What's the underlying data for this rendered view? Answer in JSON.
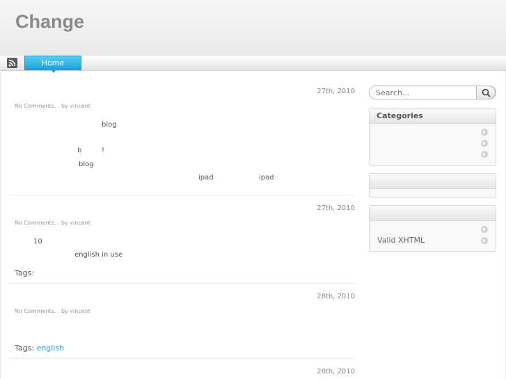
{
  "header": {
    "title": "Change"
  },
  "nav": {
    "home_label": "Home"
  },
  "posts": [
    {
      "date": "27th, 2010",
      "meta": "No Comments.    . by vincent",
      "lines": [
        "blog",
        "b",
        "!",
        "blog",
        "ipad",
        "ipad"
      ]
    },
    {
      "date": "27th, 2010",
      "meta": "No Comments.    . by vincent",
      "lines": [
        "10",
        "english in use"
      ],
      "tags_label": "Tags:"
    },
    {
      "date": "28th, 2010",
      "meta": "No Comments.    . by vincent",
      "tags_label": "Tags:",
      "tag_link": "english"
    },
    {
      "date": "28th, 2010"
    }
  ],
  "sidebar": {
    "search_placeholder": "Search...",
    "categories_title": "Categories",
    "meta_valid_xhtml": "Valid XHTML"
  },
  "colors": {
    "accent": "#1ca3d8",
    "link": "#2aa3d3",
    "title": "#8a8a8a"
  }
}
